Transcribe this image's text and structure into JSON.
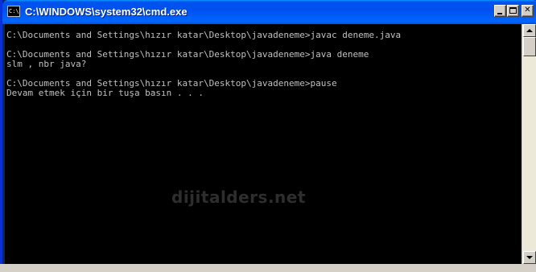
{
  "window": {
    "title": "C:\\WINDOWS\\system32\\cmd.exe",
    "icon": "command-prompt-icon",
    "buttons": {
      "minimize": "minimize-icon",
      "maximize": "maximize-icon",
      "close_label": "✕"
    }
  },
  "console": {
    "lines": [
      "C:\\Documents and Settings\\hızır katar\\Desktop\\javadeneme>javac deneme.java",
      "",
      "C:\\Documents and Settings\\hızır katar\\Desktop\\javadeneme>java deneme",
      "slm , nbr java?",
      "",
      "C:\\Documents and Settings\\hızır katar\\Desktop\\javadeneme>pause",
      "Devam etmek için bir tuşa basın . . ."
    ],
    "text_color": "#c0c0c0",
    "background": "#000000"
  },
  "watermark": {
    "text": "dijitalders.net"
  },
  "scrollbar": {
    "up_icon": "arrow-up-icon",
    "down_icon": "arrow-down-icon"
  },
  "colors": {
    "titlebar": "#0058ee",
    "frame": "#0831d9",
    "chrome": "#d4d0c8"
  }
}
